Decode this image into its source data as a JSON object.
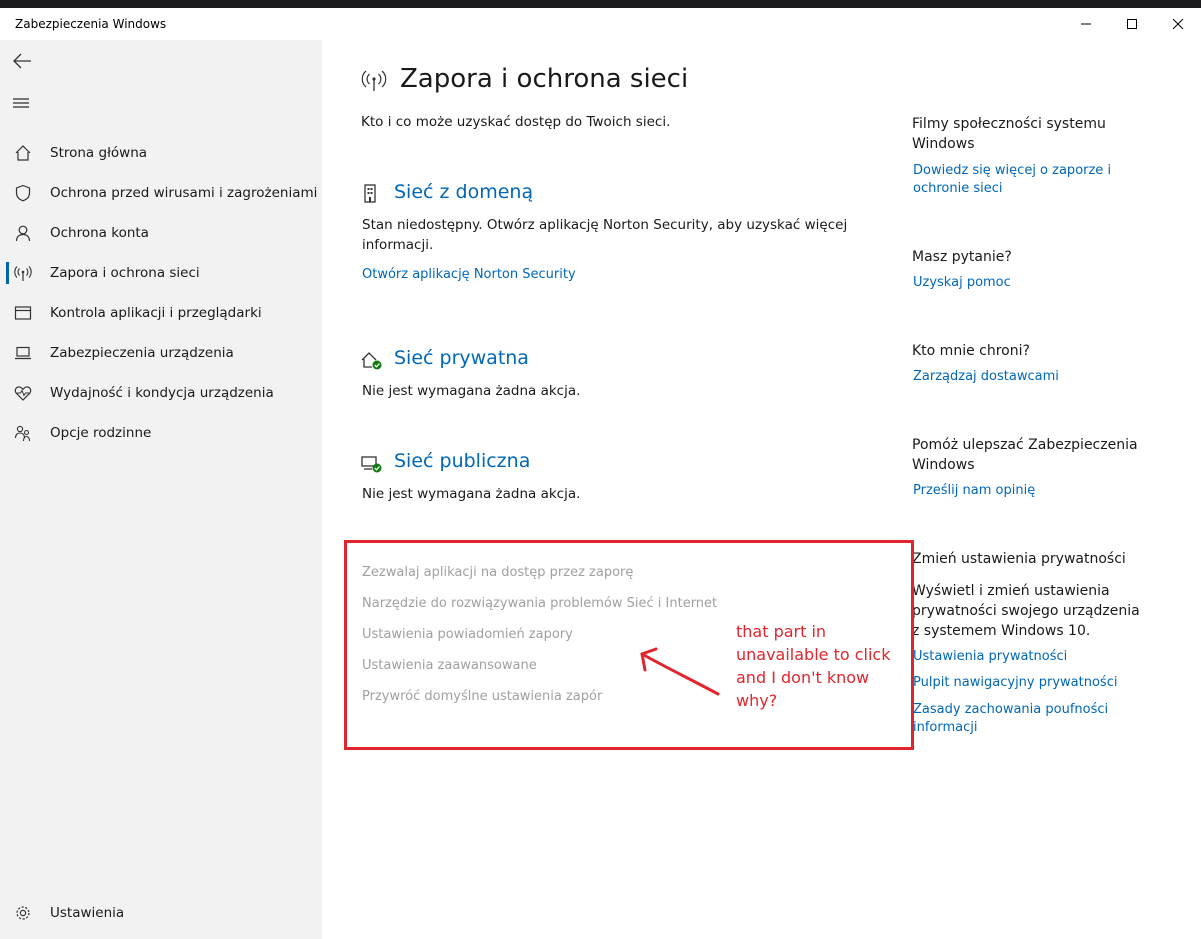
{
  "window": {
    "title": "Zabezpieczenia Windows"
  },
  "sidebar": {
    "items": [
      {
        "label": "Strona główna",
        "icon": "home-icon"
      },
      {
        "label": "Ochrona przed wirusami i zagrożeniami",
        "icon": "shield-icon"
      },
      {
        "label": "Ochrona konta",
        "icon": "person-icon"
      },
      {
        "label": "Zapora i ochrona sieci",
        "icon": "wireless-antenna-icon",
        "selected": true
      },
      {
        "label": "Kontrola aplikacji i przeglądarki",
        "icon": "browser-window-icon"
      },
      {
        "label": "Zabezpieczenia urządzenia",
        "icon": "laptop-icon"
      },
      {
        "label": "Wydajność i kondycja urządzenia",
        "icon": "heart-pulse-icon"
      },
      {
        "label": "Opcje rodzinne",
        "icon": "family-icon"
      }
    ],
    "settings_label": "Ustawienia"
  },
  "main": {
    "title": "Zapora i ochrona sieci",
    "subtitle": "Kto i co może uzyskać dostęp do Twoich sieci.",
    "domain": {
      "title": "Sieć z domeną",
      "status": "Stan niedostępny. Otwórz aplikację Norton Security, aby uzyskać więcej informacji.",
      "link": "Otwórz aplikację Norton Security"
    },
    "private": {
      "title": "Sieć prywatna",
      "status": "Nie jest wymagana żadna akcja."
    },
    "public": {
      "title": "Sieć publiczna",
      "status": "Nie jest wymagana żadna akcja."
    },
    "disabled_links": [
      "Zezwalaj aplikacji na dostęp przez zaporę",
      "Narzędzie do rozwiązywania problemów Sieć i Internet",
      "Ustawienia powiadomień zapory",
      "Ustawienia zaawansowane",
      "Przywróć domyślne ustawienia zapór"
    ]
  },
  "annotation": {
    "text": "that part in unavailable to click and I don't know why?",
    "color": "#e2252c"
  },
  "right": {
    "community_heading": "Filmy społeczności systemu Windows",
    "community_link": "Dowiedz się więcej o zaporze i ochronie sieci",
    "question_heading": "Masz pytanie?",
    "question_link": "Uzyskaj pomoc",
    "protect_heading": "Kto mnie chroni?",
    "protect_link": "Zarządzaj dostawcami",
    "improve_heading": "Pomóż ulepszać Zabezpieczenia Windows",
    "improve_link": "Prześlij nam opinię",
    "privacy_heading": "Zmień ustawienia prywatności",
    "privacy_text": "Wyświetl i zmień ustawienia prywatności swojego urządzenia z systemem Windows 10.",
    "privacy_links": [
      "Ustawienia prywatności",
      "Pulpit nawigacyjny prywatności",
      "Zasady zachowania poufności informacji"
    ]
  },
  "colors": {
    "accent": "#0067b8",
    "sidebar_bg": "#f2f2f2",
    "disabled_text": "#a0a0a0",
    "status_ok": "#107c10"
  }
}
